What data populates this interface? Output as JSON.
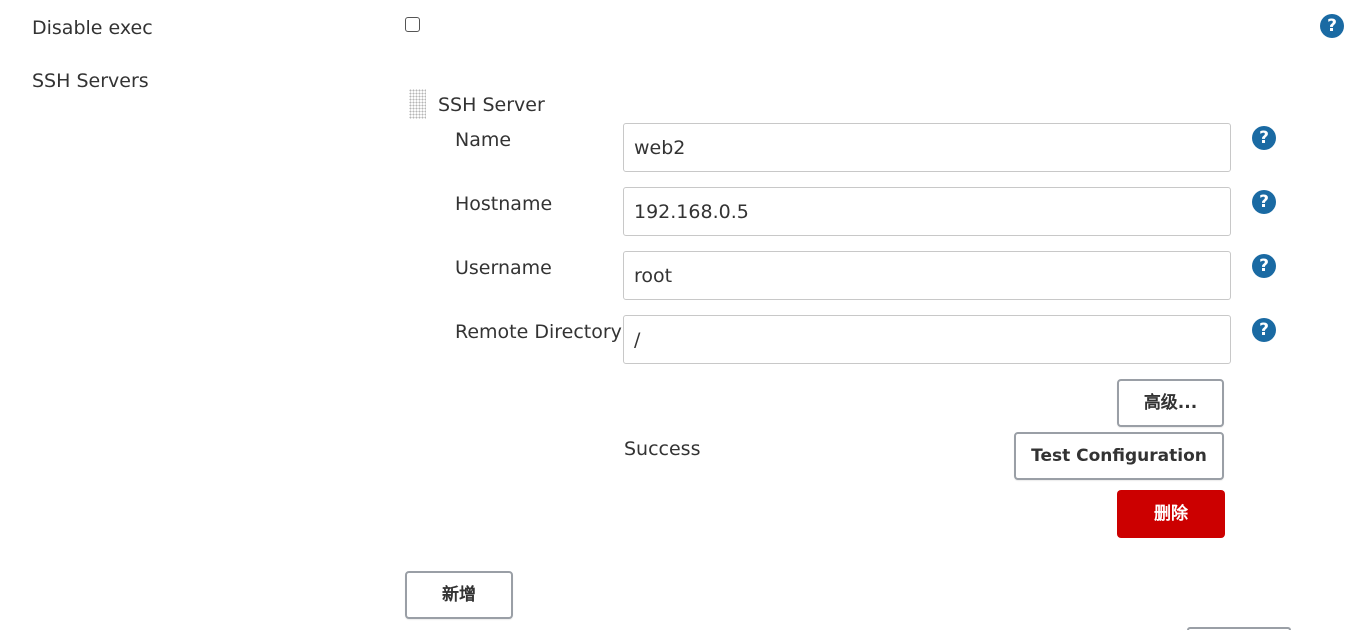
{
  "disable_exec": {
    "label": "Disable exec",
    "checked": false,
    "help_icon": "question-circle-icon",
    "help_symbol": "?"
  },
  "ssh_servers": {
    "label": "SSH Servers",
    "server": {
      "title": "SSH Server",
      "drag_icon": "drag-handle-icon",
      "fields": [
        {
          "label": "Name",
          "value": "web2",
          "help_symbol": "?"
        },
        {
          "label": "Hostname",
          "value": "192.168.0.5",
          "help_symbol": "?"
        },
        {
          "label": "Username",
          "value": "root",
          "help_symbol": "?"
        },
        {
          "label": "Remote Directory",
          "value": "/",
          "help_symbol": "?"
        }
      ],
      "advanced_button": "高级...",
      "status_text": "Success",
      "test_button": "Test Configuration",
      "delete_button": "删除"
    },
    "add_button": "新增"
  },
  "colors": {
    "help_icon": "#1a6aa3",
    "danger": "#cc0000",
    "button_border": "#9a9fa6",
    "input_border": "#c8c8c8",
    "text": "#333333"
  }
}
